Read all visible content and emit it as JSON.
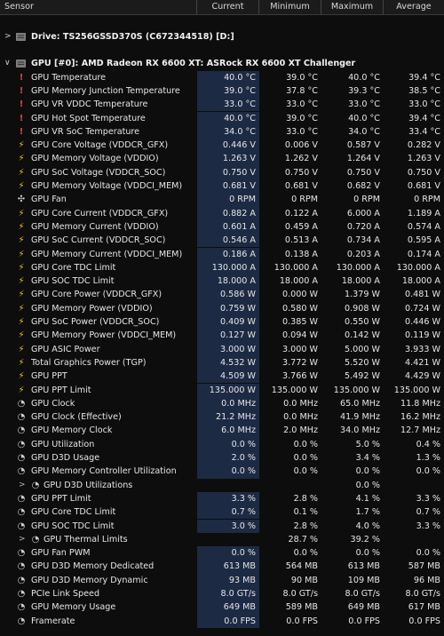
{
  "header": {
    "sensor": "Sensor",
    "current": "Current",
    "minimum": "Minimum",
    "maximum": "Maximum",
    "average": "Average"
  },
  "drive_group": {
    "caret": ">",
    "name": "Drive: TS256GSSD370S (C672344518) [D:]"
  },
  "gpu_group": {
    "caret": "∨",
    "name": "GPU [#0]: AMD Radeon RX 6600 XT: ASRock RX 6600 XT Challenger"
  },
  "rows": [
    {
      "icon": "thermometer-icon",
      "label": "GPU Temperature",
      "cur": "40.0 °C",
      "min": "39.0 °C",
      "max": "40.0 °C",
      "avg": "39.4 °C"
    },
    {
      "icon": "thermometer-icon",
      "label": "GPU Memory Junction Temperature",
      "cur": "39.0 °C",
      "min": "37.8 °C",
      "max": "39.3 °C",
      "avg": "38.5 °C"
    },
    {
      "icon": "thermometer-icon",
      "label": "GPU VR VDDC Temperature",
      "cur": "33.0 °C",
      "min": "33.0 °C",
      "max": "33.0 °C",
      "avg": "33.0 °C"
    },
    {
      "icon": "thermometer-icon",
      "label": "GPU Hot Spot Temperature",
      "cur": "40.0 °C",
      "min": "39.0 °C",
      "max": "40.0 °C",
      "avg": "39.4 °C"
    },
    {
      "icon": "thermometer-icon",
      "label": "GPU VR SoC Temperature",
      "cur": "34.0 °C",
      "min": "33.0 °C",
      "max": "34.0 °C",
      "avg": "33.4 °C"
    },
    {
      "icon": "lightning-icon",
      "label": "GPU Core Voltage (VDDCR_GFX)",
      "cur": "0.446 V",
      "min": "0.006 V",
      "max": "0.587 V",
      "avg": "0.282 V"
    },
    {
      "icon": "lightning-icon",
      "label": "GPU Memory Voltage (VDDIO)",
      "cur": "1.263 V",
      "min": "1.262 V",
      "max": "1.264 V",
      "avg": "1.263 V"
    },
    {
      "icon": "lightning-icon",
      "label": "GPU SoC Voltage (VDDCR_SOC)",
      "cur": "0.750 V",
      "min": "0.750 V",
      "max": "0.750 V",
      "avg": "0.750 V"
    },
    {
      "icon": "lightning-icon",
      "label": "GPU Memory Voltage (VDDCI_MEM)",
      "cur": "0.681 V",
      "min": "0.681 V",
      "max": "0.682 V",
      "avg": "0.681 V"
    },
    {
      "icon": "fan-icon",
      "label": "GPU Fan",
      "cur": "0 RPM",
      "min": "0 RPM",
      "max": "0 RPM",
      "avg": "0 RPM"
    },
    {
      "icon": "lightning-icon",
      "label": "GPU Core Current (VDDCR_GFX)",
      "cur": "0.882 A",
      "min": "0.122 A",
      "max": "6.000 A",
      "avg": "1.189 A"
    },
    {
      "icon": "lightning-icon",
      "label": "GPU Memory Current (VDDIO)",
      "cur": "0.601 A",
      "min": "0.459 A",
      "max": "0.720 A",
      "avg": "0.574 A"
    },
    {
      "icon": "lightning-icon",
      "label": "GPU SoC Current (VDDCR_SOC)",
      "cur": "0.546 A",
      "min": "0.513 A",
      "max": "0.734 A",
      "avg": "0.595 A"
    },
    {
      "icon": "lightning-icon",
      "label": "GPU Memory Current (VDDCI_MEM)",
      "cur": "0.186 A",
      "min": "0.138 A",
      "max": "0.203 A",
      "avg": "0.174 A"
    },
    {
      "icon": "lightning-icon",
      "label": "GPU Core TDC Limit",
      "cur": "130.000 A",
      "min": "130.000 A",
      "max": "130.000 A",
      "avg": "130.000 A"
    },
    {
      "icon": "lightning-icon",
      "label": "GPU SOC TDC Limit",
      "cur": "18.000 A",
      "min": "18.000 A",
      "max": "18.000 A",
      "avg": "18.000 A"
    },
    {
      "icon": "lightning-icon",
      "label": "GPU Core Power (VDDCR_GFX)",
      "cur": "0.586 W",
      "min": "0.000 W",
      "max": "1.379 W",
      "avg": "0.481 W"
    },
    {
      "icon": "lightning-icon",
      "label": "GPU Memory Power (VDDIO)",
      "cur": "0.759 W",
      "min": "0.580 W",
      "max": "0.908 W",
      "avg": "0.724 W"
    },
    {
      "icon": "lightning-icon",
      "label": "GPU SoC Power (VDDCR_SOC)",
      "cur": "0.409 W",
      "min": "0.385 W",
      "max": "0.550 W",
      "avg": "0.446 W"
    },
    {
      "icon": "lightning-icon",
      "label": "GPU Memory Power (VDDCI_MEM)",
      "cur": "0.127 W",
      "min": "0.094 W",
      "max": "0.142 W",
      "avg": "0.119 W"
    },
    {
      "icon": "lightning-icon",
      "label": "GPU ASIC Power",
      "cur": "3.000 W",
      "min": "3.000 W",
      "max": "5.000 W",
      "avg": "3.933 W"
    },
    {
      "icon": "lightning-icon",
      "label": "Total Graphics Power (TGP)",
      "cur": "4.532 W",
      "min": "3.772 W",
      "max": "5.520 W",
      "avg": "4.421 W"
    },
    {
      "icon": "lightning-icon",
      "label": "GPU PPT",
      "cur": "4.509 W",
      "min": "3.766 W",
      "max": "5.492 W",
      "avg": "4.429 W"
    },
    {
      "icon": "lightning-icon",
      "label": "GPU PPT Limit",
      "cur": "135.000 W",
      "min": "135.000 W",
      "max": "135.000 W",
      "avg": "135.000 W"
    },
    {
      "icon": "clock-icon",
      "label": "GPU Clock",
      "cur": "0.0 MHz",
      "min": "0.0 MHz",
      "max": "65.0 MHz",
      "avg": "11.8 MHz"
    },
    {
      "icon": "clock-icon",
      "label": "GPU Clock (Effective)",
      "cur": "21.2 MHz",
      "min": "0.0 MHz",
      "max": "41.9 MHz",
      "avg": "16.2 MHz"
    },
    {
      "icon": "clock-icon",
      "label": "GPU Memory Clock",
      "cur": "6.0 MHz",
      "min": "2.0 MHz",
      "max": "34.0 MHz",
      "avg": "12.7 MHz"
    },
    {
      "icon": "clock-icon",
      "label": "GPU Utilization",
      "cur": "0.0 %",
      "min": "0.0 %",
      "max": "5.0 %",
      "avg": "0.4 %"
    },
    {
      "icon": "clock-icon",
      "label": "GPU D3D Usage",
      "cur": "2.0 %",
      "min": "0.0 %",
      "max": "3.4 %",
      "avg": "1.3 %"
    },
    {
      "icon": "clock-icon",
      "label": "GPU Memory Controller Utilization",
      "cur": "0.0 %",
      "min": "0.0 %",
      "max": "0.0 %",
      "avg": "0.0 %"
    },
    {
      "icon": "clock-icon",
      "label": "GPU D3D Utilizations",
      "sub": true,
      "cur": "",
      "min": "",
      "max": "0.0 %",
      "avg": ""
    },
    {
      "icon": "clock-icon",
      "label": "GPU PPT Limit",
      "cur": "3.3 %",
      "min": "2.8 %",
      "max": "4.1 %",
      "avg": "3.3 %"
    },
    {
      "icon": "clock-icon",
      "label": "GPU Core TDC Limit",
      "cur": "0.7 %",
      "min": "0.1 %",
      "max": "1.7 %",
      "avg": "0.7 %"
    },
    {
      "icon": "clock-icon",
      "label": "GPU SOC TDC Limit",
      "cur": "3.0 %",
      "min": "2.8 %",
      "max": "4.0 %",
      "avg": "3.3 %"
    },
    {
      "icon": "clock-icon",
      "label": "GPU Thermal Limits",
      "sub": true,
      "cur": "",
      "min": "28.7 %",
      "max": "39.2 %",
      "avg": ""
    },
    {
      "icon": "clock-icon",
      "label": "GPU Fan PWM",
      "cur": "0.0 %",
      "min": "0.0 %",
      "max": "0.0 %",
      "avg": "0.0 %"
    },
    {
      "icon": "clock-icon",
      "label": "GPU D3D Memory Dedicated",
      "cur": "613 MB",
      "min": "564 MB",
      "max": "613 MB",
      "avg": "587 MB"
    },
    {
      "icon": "clock-icon",
      "label": "GPU D3D Memory Dynamic",
      "cur": "93 MB",
      "min": "90 MB",
      "max": "109 MB",
      "avg": "96 MB"
    },
    {
      "icon": "clock-icon",
      "label": "PCIe Link Speed",
      "cur": "8.0 GT/s",
      "min": "8.0 GT/s",
      "max": "8.0 GT/s",
      "avg": "8.0 GT/s"
    },
    {
      "icon": "clock-icon",
      "label": "GPU Memory Usage",
      "cur": "649 MB",
      "min": "589 MB",
      "max": "649 MB",
      "avg": "617 MB"
    },
    {
      "icon": "clock-icon",
      "label": "Framerate",
      "cur": "0.0 FPS",
      "min": "0.0 FPS",
      "max": "0.0 FPS",
      "avg": "0.0 FPS"
    }
  ],
  "colors": {
    "current_bg": "#1c2a44",
    "thermometer": "#e04040",
    "lightning": "#f0c020"
  }
}
